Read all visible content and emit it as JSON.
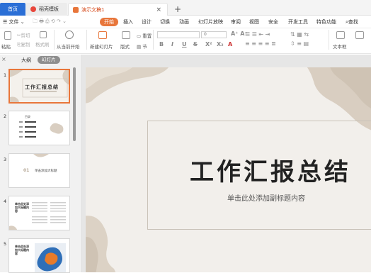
{
  "tabs": {
    "home": "首页",
    "shell": "稻壳模板",
    "doc": "演示文稿1",
    "close": "×",
    "add": "+"
  },
  "menu": {
    "file": "文件",
    "start": "开始",
    "insert": "插入",
    "design": "设计",
    "switch": "切换",
    "animation": "动画",
    "slideshow": "幻灯片放映",
    "review": "审阅",
    "view": "视图",
    "security": "安全",
    "devtools": "开发工具",
    "special": "特色功能",
    "search": "查找"
  },
  "toolbar": {
    "paste": "粘贴",
    "cut": "剪切",
    "copy": "复制",
    "format_painter": "格式刷",
    "play_from_current": "从当前开始",
    "new_slide": "新建幻灯片",
    "layout": "版式",
    "section": "节",
    "reset": "重置",
    "font_size": "0",
    "bold": "B",
    "italic": "I",
    "underline": "U",
    "strike": "S",
    "superscript": "X²",
    "subscript": "X₂",
    "font_color": "A",
    "textbox": "文本框"
  },
  "panel": {
    "outline": "大纲",
    "slides": "幻灯片",
    "close": "×"
  },
  "thumbnails": [
    {
      "num": "1",
      "title": "工作汇报总结"
    },
    {
      "num": "2",
      "title": "目录"
    },
    {
      "num": "3",
      "title": "单击添加大标题",
      "index": "01"
    },
    {
      "num": "4",
      "title": "单击此处添加大标题内容"
    },
    {
      "num": "5",
      "title": "单击此处添加大标题内容"
    }
  ],
  "slide": {
    "title": "工作汇报总结",
    "subtitle": "单击此处添加副标题内容"
  },
  "colors": {
    "accent": "#e8763b",
    "tab_home": "#2b6fd6",
    "slide_bg": "#f2efeb",
    "blob": "#d9cec1"
  }
}
